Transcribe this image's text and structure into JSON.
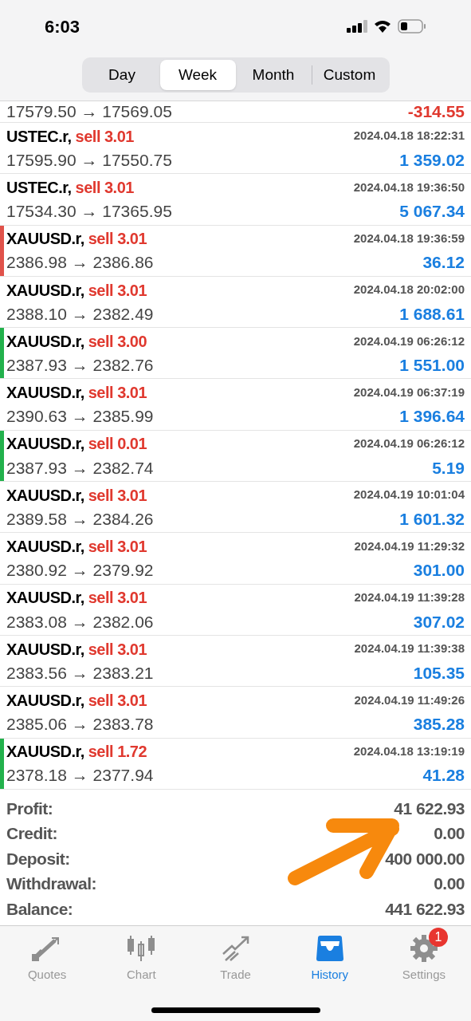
{
  "status_bar": {
    "time": "6:03"
  },
  "period_tabs": [
    {
      "label": "Day",
      "selected": false
    },
    {
      "label": "Week",
      "selected": true
    },
    {
      "label": "Month",
      "selected": false
    },
    {
      "label": "Custom",
      "selected": false
    }
  ],
  "partial_row": {
    "prices": "17579.50 → 17569.05",
    "profit": "-314.55",
    "negative": true
  },
  "deals": [
    {
      "symbol": "USTEC.r,",
      "side": "sell 3.01",
      "time": "2024.04.18 18:22:31",
      "prices": "17595.90 → 17550.75",
      "profit": "1 359.02",
      "negative": false
    },
    {
      "symbol": "USTEC.r,",
      "side": "sell 3.01",
      "time": "2024.04.18 19:36:50",
      "prices": "17534.30 → 17365.95",
      "profit": "5 067.34",
      "negative": false
    },
    {
      "symbol": "XAUUSD.r,",
      "side": "sell 3.01",
      "time": "2024.04.18 19:36:59",
      "prices": "2386.98 → 2386.86",
      "profit": "36.12",
      "negative": false,
      "color": "#e0524a"
    },
    {
      "symbol": "XAUUSD.r,",
      "side": "sell 3.01",
      "time": "2024.04.18 20:02:00",
      "prices": "2388.10 → 2382.49",
      "profit": "1 688.61",
      "negative": false
    },
    {
      "symbol": "XAUUSD.r,",
      "side": "sell 3.00",
      "time": "2024.04.19 06:26:12",
      "prices": "2387.93 → 2382.76",
      "profit": "1 551.00",
      "negative": false,
      "color": "#22b14c"
    },
    {
      "symbol": "XAUUSD.r,",
      "side": "sell 3.01",
      "time": "2024.04.19 06:37:19",
      "prices": "2390.63 → 2385.99",
      "profit": "1 396.64",
      "negative": false
    },
    {
      "symbol": "XAUUSD.r,",
      "side": "sell 0.01",
      "time": "2024.04.19 06:26:12",
      "prices": "2387.93 → 2382.74",
      "profit": "5.19",
      "negative": false,
      "color": "#22b14c"
    },
    {
      "symbol": "XAUUSD.r,",
      "side": "sell 3.01",
      "time": "2024.04.19 10:01:04",
      "prices": "2389.58 → 2384.26",
      "profit": "1 601.32",
      "negative": false
    },
    {
      "symbol": "XAUUSD.r,",
      "side": "sell 3.01",
      "time": "2024.04.19 11:29:32",
      "prices": "2380.92 → 2379.92",
      "profit": "301.00",
      "negative": false
    },
    {
      "symbol": "XAUUSD.r,",
      "side": "sell 3.01",
      "time": "2024.04.19 11:39:28",
      "prices": "2383.08 → 2382.06",
      "profit": "307.02",
      "negative": false
    },
    {
      "symbol": "XAUUSD.r,",
      "side": "sell 3.01",
      "time": "2024.04.19 11:39:38",
      "prices": "2383.56 → 2383.21",
      "profit": "105.35",
      "negative": false
    },
    {
      "symbol": "XAUUSD.r,",
      "side": "sell 3.01",
      "time": "2024.04.19 11:49:26",
      "prices": "2385.06 → 2383.78",
      "profit": "385.28",
      "negative": false
    },
    {
      "symbol": "XAUUSD.r,",
      "side": "sell 1.72",
      "time": "2024.04.18 13:19:19",
      "prices": "2378.18 → 2377.94",
      "profit": "41.28",
      "negative": false,
      "color": "#22b14c"
    }
  ],
  "summary": [
    {
      "label": "Profit:",
      "value": "41 622.93"
    },
    {
      "label": "Credit:",
      "value": "0.00"
    },
    {
      "label": "Deposit:",
      "value": "400 000.00"
    },
    {
      "label": "Withdrawal:",
      "value": "0.00"
    },
    {
      "label": "Balance:",
      "value": "441 622.93"
    }
  ],
  "tab_bar": [
    {
      "kind": "quotes",
      "label": "Quotes",
      "selected": false
    },
    {
      "kind": "chart",
      "label": "Chart",
      "selected": false
    },
    {
      "kind": "trade",
      "label": "Trade",
      "selected": false
    },
    {
      "kind": "history",
      "label": "History",
      "selected": true
    },
    {
      "kind": "settings",
      "label": "Settings",
      "selected": false,
      "badge": "1"
    }
  ]
}
